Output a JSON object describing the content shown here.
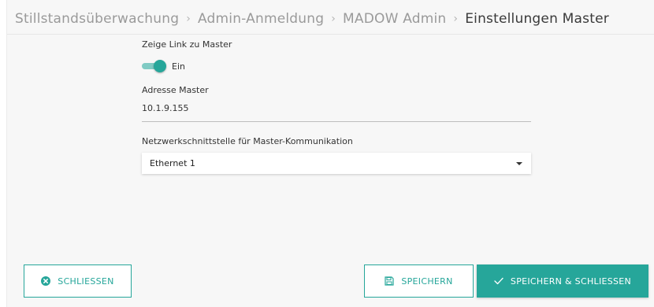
{
  "breadcrumb": {
    "items": [
      "Stillstandsüberwachung",
      "Admin-Anmeldung",
      "MADOW Admin"
    ],
    "current": "Einstellungen Master"
  },
  "form": {
    "show_link_label": "Zeige Link zu Master",
    "toggle_state": "Ein",
    "toggle_on": true,
    "address_label": "Adresse Master",
    "address_value": "10.1.9.155",
    "interface_label": "Netzwerkschnittstelle für Master-Kommunikation",
    "interface_selected": "Ethernet 1"
  },
  "buttons": {
    "close": "SCHLIEßEN",
    "save": "SPEICHERN",
    "save_close": "SPEICHERN & SCHLIEßEN"
  },
  "icons": {
    "close": "close-circle-icon",
    "save": "floppy-disk-icon",
    "save_close": "checkmark-icon",
    "breadcrumb_separator": "chevron-right-icon",
    "select_caret": "caret-down-icon"
  },
  "colors": {
    "accent": "#26a69a",
    "toggle_track": "#80cbc4",
    "background": "#f7f7f7"
  }
}
